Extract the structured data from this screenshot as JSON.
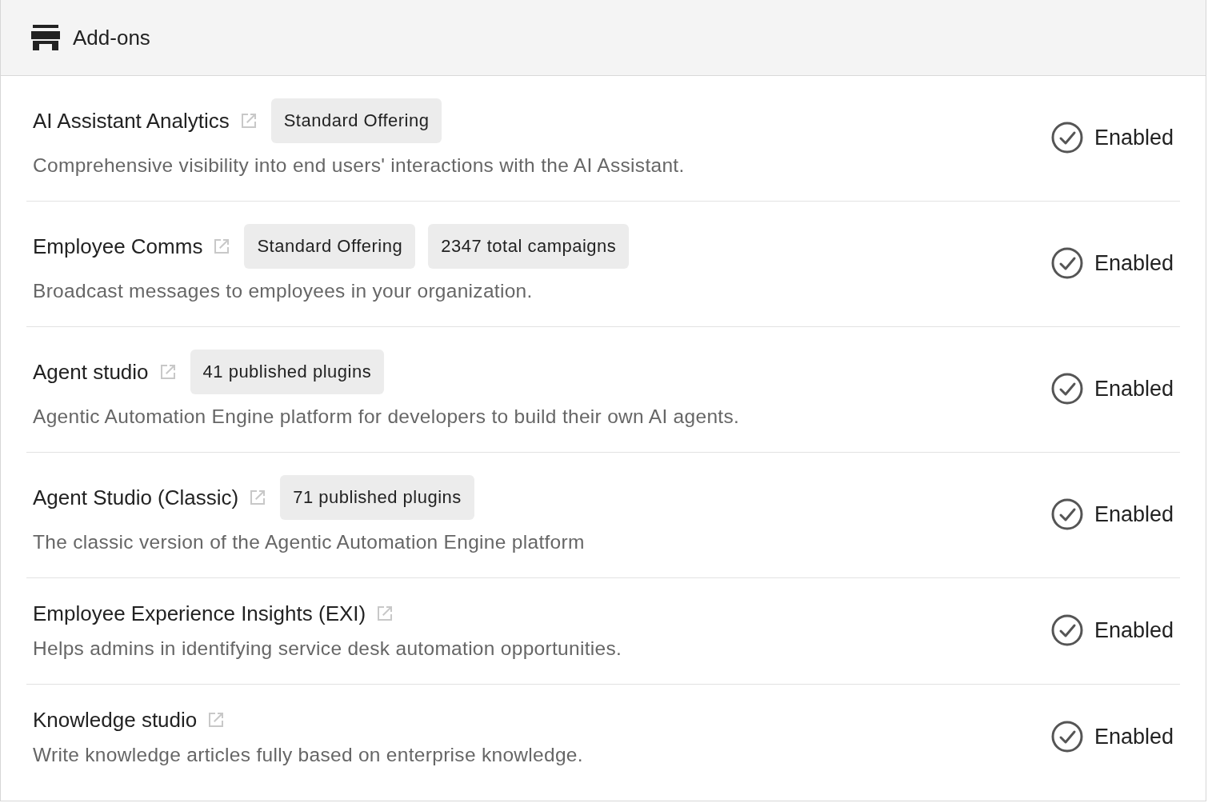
{
  "header": {
    "title": "Add-ons"
  },
  "addons": [
    {
      "name": "AI Assistant Analytics",
      "tags": [
        "Standard Offering"
      ],
      "description": "Comprehensive visibility into end users' interactions with the AI Assistant.",
      "enabled": true,
      "status": "Enabled"
    },
    {
      "name": "Employee Comms",
      "tags": [
        "Standard Offering",
        "2347 total campaigns"
      ],
      "description": "Broadcast messages to employees in your organization.",
      "enabled": true,
      "status": "Enabled"
    },
    {
      "name": "Agent studio",
      "tags": [
        "41 published plugins"
      ],
      "description": "Agentic Automation Engine platform for developers to build their own AI agents.",
      "enabled": true,
      "status": "Enabled"
    },
    {
      "name": "Agent Studio (Classic)",
      "tags": [
        "71 published plugins"
      ],
      "description": "The classic version of the Agentic Automation Engine platform",
      "enabled": true,
      "status": "Enabled"
    },
    {
      "name": "Employee Experience Insights (EXI)",
      "description": "Helps admins in identifying service desk automation opportunities.",
      "enabled": true,
      "status": "Enabled"
    },
    {
      "name": "Knowledge studio",
      "description": "Write knowledge articles fully based on enterprise knowledge.",
      "enabled": true,
      "status": "Enabled"
    }
  ]
}
